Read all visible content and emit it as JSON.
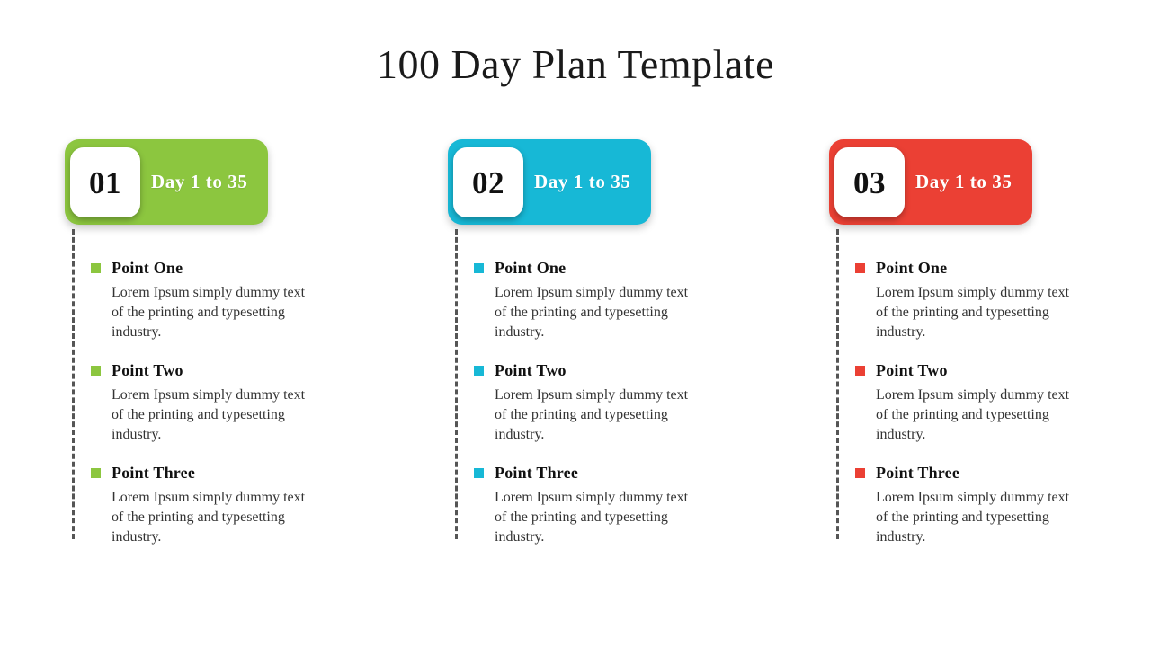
{
  "slide": {
    "title": "100 Day Plan Template",
    "background": "#FFFFFF"
  },
  "colors": {
    "green": "#8CC63F",
    "blue": "#17B8D6",
    "red": "#EB4034",
    "dash_line": "#555555",
    "title_text": "#1A1A1A",
    "body_text": "#333333"
  },
  "columns": [
    {
      "number": "01",
      "label": "Day 1 to 35",
      "accent": "#8CC63F",
      "points": [
        {
          "title": "Point One",
          "body": "Lorem Ipsum simply dummy text of the printing and typesetting industry."
        },
        {
          "title": "Point Two",
          "body": "Lorem Ipsum simply dummy text of the printing and typesetting industry."
        },
        {
          "title": "Point Three",
          "body": "Lorem Ipsum simply dummy text of the printing and typesetting industry."
        }
      ]
    },
    {
      "number": "02",
      "label": "Day 1 to 35",
      "accent": "#17B8D6",
      "points": [
        {
          "title": "Point One",
          "body": "Lorem Ipsum simply dummy text of the printing and typesetting industry."
        },
        {
          "title": "Point Two",
          "body": "Lorem Ipsum simply dummy text of the printing and typesetting industry."
        },
        {
          "title": "Point Three",
          "body": "Lorem Ipsum simply dummy text of the printing and typesetting industry."
        }
      ]
    },
    {
      "number": "03",
      "label": "Day 1 to 35",
      "accent": "#EB4034",
      "points": [
        {
          "title": "Point One",
          "body": "Lorem Ipsum simply dummy text of the printing and typesetting industry."
        },
        {
          "title": "Point Two",
          "body": "Lorem Ipsum simply dummy text of the printing and typesetting industry."
        },
        {
          "title": "Point Three",
          "body": "Lorem Ipsum simply dummy text of the printing and typesetting industry."
        }
      ]
    }
  ]
}
